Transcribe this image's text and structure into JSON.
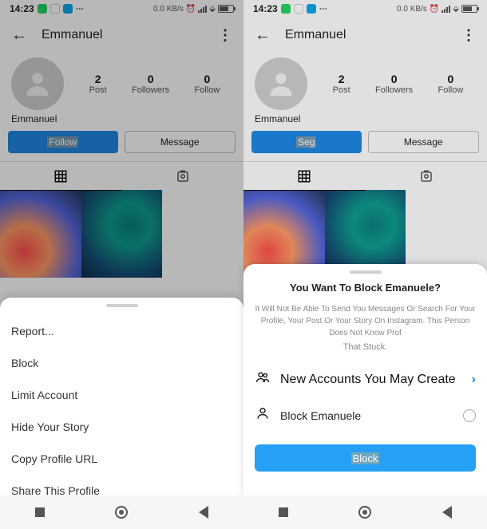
{
  "status": {
    "time": "14:23",
    "net": "0.0 KB/s",
    "battery_left": "50",
    "battery_right": "58"
  },
  "profile": {
    "title": "Emmanuel",
    "username": "Emmanuel",
    "posts_num": "2",
    "posts_lbl": "Post",
    "followers_num": "0",
    "followers_lbl": "Followers",
    "following_num": "0",
    "following_lbl": "Follow",
    "follow_btn": "Follow",
    "seg_btn": "Seg",
    "message_btn": "Message"
  },
  "sheet1": {
    "report": "Report...",
    "block": "Block",
    "limit": "Limit Account",
    "hide": "Hide Your Story",
    "copy": "Copy Profile URL",
    "share": "Share This Profile"
  },
  "sheet2": {
    "title": "You Want To Block Emanuele?",
    "desc": "It Will Not Be Able To Send You Messages Or Search For Your Profile, Your Post Or Your Story On Instagram. This Person Does Not Know Prof",
    "stuck": "That Stuck.",
    "opt1_sub": "New Accounts You May Create",
    "opt2": "Block Emanuele",
    "block_btn": "Block"
  }
}
